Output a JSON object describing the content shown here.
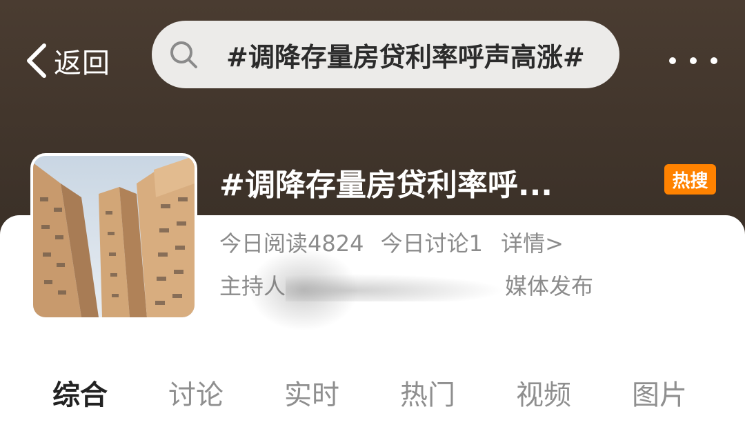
{
  "nav": {
    "back_label": "返回",
    "search_text": "#调降存量房贷利率呼声高涨#"
  },
  "topic": {
    "title": "#调降存量房贷利率呼...",
    "badge": "热搜",
    "badge_color": "#ff8200",
    "read_stat": "今日阅读4824",
    "discuss_stat": "今日讨论1",
    "detail_link": "详情>",
    "host_prefix": "主持人",
    "host_suffix": "媒体发布"
  },
  "tabs": [
    {
      "label": "综合",
      "active": true
    },
    {
      "label": "讨论",
      "active": false
    },
    {
      "label": "实时",
      "active": false
    },
    {
      "label": "热门",
      "active": false
    },
    {
      "label": "视频",
      "active": false
    },
    {
      "label": "图片",
      "active": false
    }
  ]
}
